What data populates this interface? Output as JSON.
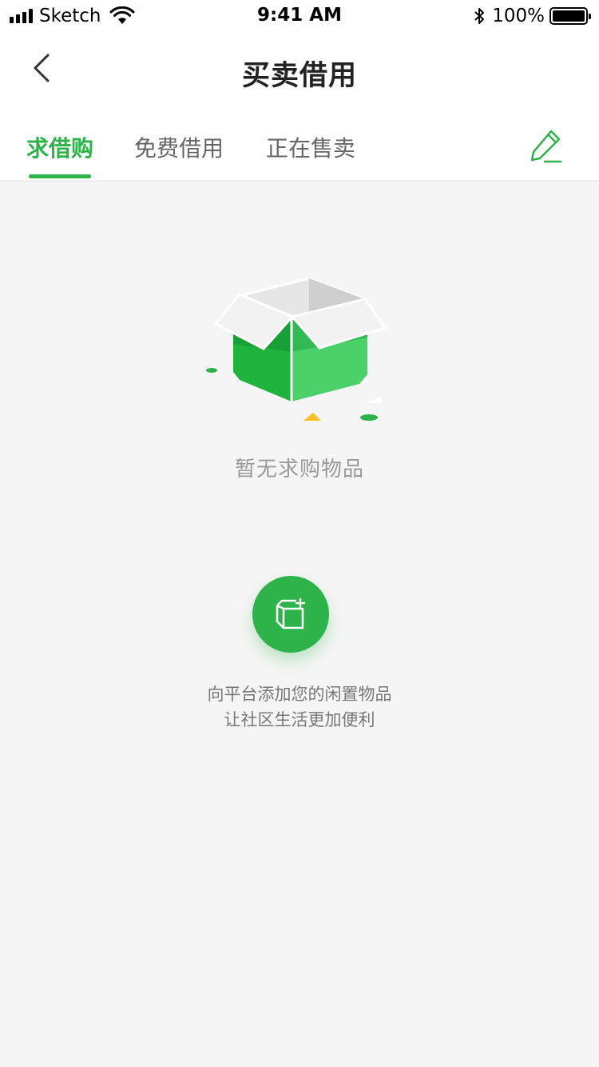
{
  "status_bar": {
    "carrier": "Sketch",
    "time": "9:41 AM",
    "battery_percent": "100%"
  },
  "nav": {
    "title": "买卖借用",
    "back_icon": "chevron-left-icon"
  },
  "tabs": [
    {
      "label": "求借购",
      "active": true
    },
    {
      "label": "免费借用",
      "active": false
    },
    {
      "label": "正在售卖",
      "active": false
    }
  ],
  "edit_icon": "pencil-icon",
  "empty_state": {
    "illustration": "open-box-icon",
    "message": "暂无求购物品"
  },
  "add_button": {
    "icon": "box-add-icon"
  },
  "hint": {
    "line1": "向平台添加您的闲置物品",
    "line2": "让社区生活更加便利"
  },
  "colors": {
    "accent": "#2db34a",
    "background": "#f5f5f5"
  }
}
